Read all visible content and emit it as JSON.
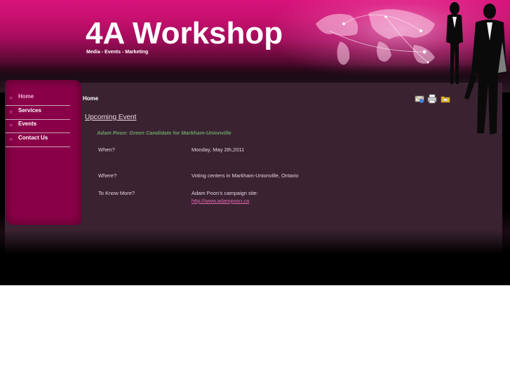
{
  "site": {
    "title": "4A Workshop",
    "tagline": "Media - Events - Marketing"
  },
  "nav": {
    "items": [
      {
        "label": "Home",
        "active": true
      },
      {
        "label": "Services",
        "active": false
      },
      {
        "label": "Events",
        "active": false
      },
      {
        "label": "Contact Us",
        "active": false
      }
    ]
  },
  "breadcrumb": "Home",
  "tools": {
    "icons": [
      "email-icon",
      "print-icon",
      "folder-icon"
    ]
  },
  "content": {
    "heading": "Upcoming Event",
    "event_title": "Adam Poon: Green Candidate for Markham-Unionville",
    "rows": [
      {
        "label": "When?",
        "value": "Monday, May 2th,2011"
      },
      {
        "label": "Where?",
        "value": "Voting centers in Markham-Unionville, Ontario"
      },
      {
        "label": "To Know More?",
        "value": "Adam Poon's campaign site:"
      }
    ],
    "link": "http://www.adampoon.ca"
  },
  "colors": {
    "brand_pink": "#d8127a",
    "sidebar": "#8a0048",
    "panel": "#3a2231",
    "event_title": "#6aa06a",
    "link": "#e06ab0"
  }
}
